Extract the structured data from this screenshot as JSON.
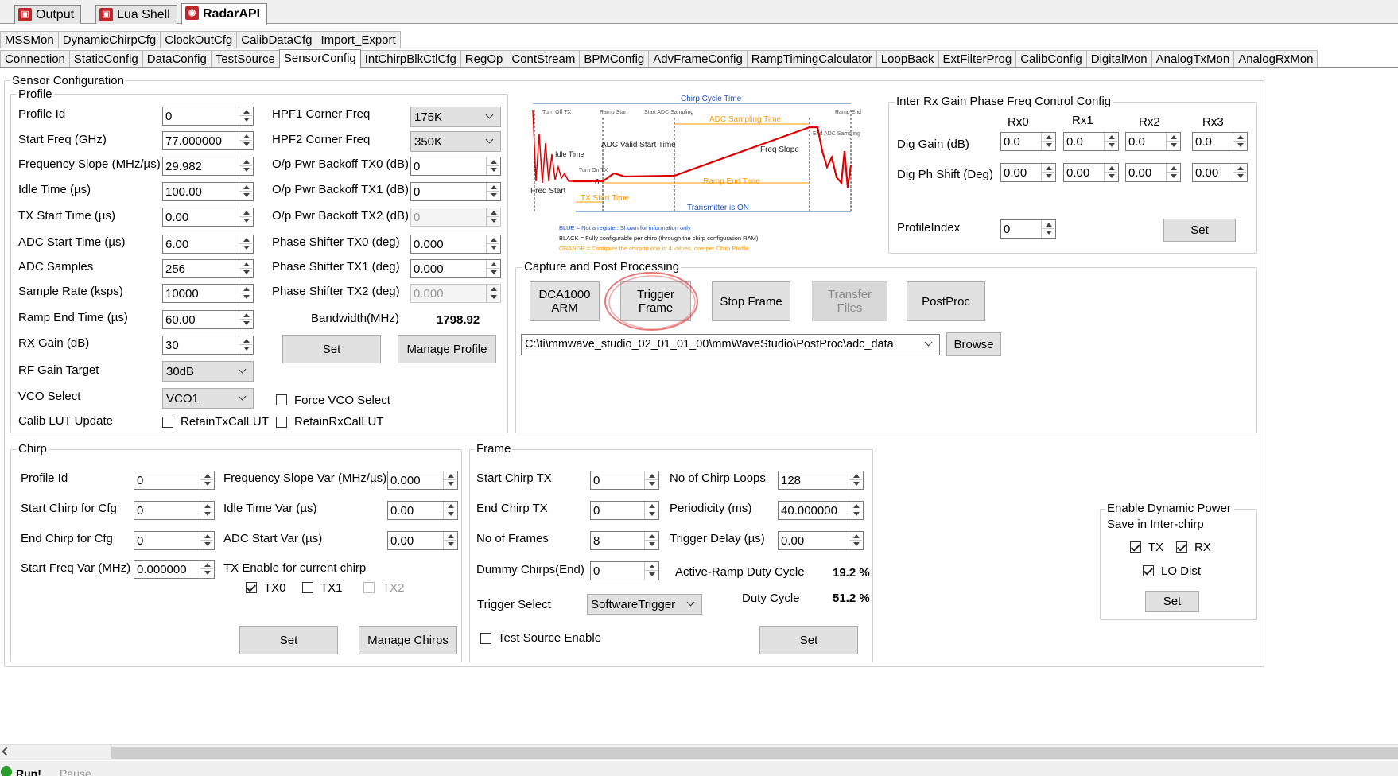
{
  "window_tabs": [
    {
      "label": "Output"
    },
    {
      "label": "Lua Shell"
    },
    {
      "label": "RadarAPI"
    }
  ],
  "tabs_row1": [
    "MSSMon",
    "DynamicChirpCfg",
    "ClockOutCfg",
    "CalibDataCfg",
    "Import_Export"
  ],
  "tabs_row2": [
    "Connection",
    "StaticConfig",
    "DataConfig",
    "TestSource",
    "SensorConfig",
    "IntChirpBlkCtlCfg",
    "RegOp",
    "ContStream",
    "BPMConfig",
    "AdvFrameConfig",
    "RampTimingCalculator",
    "LoopBack",
    "ExtFilterProg",
    "CalibConfig",
    "DigitalMon",
    "AnalogTxMon",
    "AnalogRxMon"
  ],
  "active_tab": "SensorConfig",
  "sensor_config": {
    "title": "Sensor Configuration"
  },
  "profile": {
    "title": "Profile",
    "labels": {
      "profile_id": "Profile Id",
      "start_freq": "Start Freq (GHz)",
      "freq_slope": "Frequency Slope (MHz/µs)",
      "idle_time": "Idle Time (µs)",
      "tx_start": "TX Start Time (µs)",
      "adc_start": "ADC Start Time (µs)",
      "adc_samples": "ADC Samples",
      "sample_rate": "Sample Rate (ksps)",
      "ramp_end": "Ramp End Time (µs)",
      "rx_gain": "RX Gain (dB)",
      "rf_gain": "RF Gain Target",
      "vco": "VCO Select",
      "calib_lut": "Calib LUT Update"
    },
    "values": {
      "profile_id": "0",
      "start_freq": "77.000000",
      "freq_slope": "29.982",
      "idle_time": "100.00",
      "tx_start": "0.00",
      "adc_start": "6.00",
      "adc_samples": "256",
      "sample_rate": "10000",
      "ramp_end": "60.00",
      "rx_gain": "30",
      "rf_gain": "30dB",
      "vco": "VCO1"
    },
    "right_labels": {
      "hpf1": "HPF1 Corner Freq",
      "hpf2": "HPF2 Corner Freq",
      "tx0_backoff": "O/p Pwr Backoff TX0 (dB)",
      "tx1_backoff": "O/p Pwr Backoff TX1 (dB)",
      "tx2_backoff": "O/p Pwr Backoff TX2 (dB)",
      "ps_tx0": "Phase Shifter TX0 (deg)",
      "ps_tx1": "Phase Shifter TX1 (deg)",
      "ps_tx2": "Phase Shifter TX2 (deg)",
      "bandwidth": "Bandwidth(MHz)"
    },
    "right_values": {
      "hpf1": "175K",
      "hpf2": "350K",
      "tx0_backoff": "0",
      "tx1_backoff": "0",
      "tx2_backoff": "0",
      "ps_tx0": "0.000",
      "ps_tx1": "0.000",
      "ps_tx2": "0.000",
      "bandwidth": "1798.92"
    },
    "set": "Set",
    "manage": "Manage Profile",
    "force_vco": "Force VCO Select",
    "retain_tx": "RetainTxCalLUT",
    "retain_rx": "RetainRxCalLUT"
  },
  "diagram": {
    "chirp_cycle": "Chirp Cycle Time",
    "turn_off_tx": "Turn Off TX",
    "ramp_start": "Ramp Start",
    "start_adc": "Start ADC Sampling",
    "adc_sampling_time": "ADC Sampling Time",
    "ramp_end": "Ramp End",
    "end_adc": "End ADC Sampling",
    "adc_valid": "ADC Valid Start Time",
    "idle_time": "Idle Time",
    "turn_on_tx": "Turn On TX",
    "freq_slope": "Freq Slope",
    "freq_start": "Freq Start",
    "ramp_end_time": "Ramp End Time",
    "tx_start_time": "TX Start Time",
    "tx_on": "Transmitter is ON",
    "zero": "0",
    "legend_blue": "BLUE = Not a register. Shown for information only",
    "legend_black": "BLACK = Fully configurable per chirp (through the chirp configuration RAM)",
    "legend_orange": "ORANGE = Configure the chirp to one of 4 values, one per Chirp Profile"
  },
  "gain_phase": {
    "title": "Inter Rx Gain Phase Freq Control Config",
    "cols": [
      "Rx0",
      "Rx1",
      "Rx2",
      "Rx3"
    ],
    "dig_gain": "Dig Gain (dB)",
    "dig_phase": "Dig Ph Shift (Deg)",
    "gain_values": [
      "0.0",
      "0.0",
      "0.0",
      "0.0"
    ],
    "phase_values": [
      "0.00",
      "0.00",
      "0.00",
      "0.00"
    ],
    "profile_index": "ProfileIndex",
    "profile_index_value": "0",
    "set": "Set"
  },
  "capture": {
    "title": "Capture and Post Processing",
    "dca_line1": "DCA1000",
    "dca_line2": "ARM",
    "trig_line1": "Trigger",
    "trig_line2": "Frame",
    "stop": "Stop Frame",
    "transfer_line1": "Transfer",
    "transfer_line2": "Files",
    "postproc": "PostProc",
    "path": "C:\\ti\\mmwave_studio_02_01_01_00\\mmWaveStudio\\PostProc\\adc_data.",
    "browse": "Browse"
  },
  "chirp": {
    "title": "Chirp",
    "profile_id": "Profile Id",
    "start_chirp": "Start Chirp for Cfg",
    "end_chirp": "End Chirp for Cfg",
    "start_freq_var": "Start Freq Var (MHz)",
    "profile_id_v": "0",
    "start_chirp_v": "0",
    "end_chirp_v": "0",
    "start_freq_var_v": "0.000000",
    "slope_var": "Frequency Slope Var (MHz/µs)",
    "idle_var": "Idle Time Var (µs)",
    "adc_var": "ADC Start Var (µs)",
    "slope_var_v": "0.000",
    "idle_var_v": "0.00",
    "adc_var_v": "0.00",
    "tx_enable": "TX Enable for current chirp",
    "tx0": "TX0",
    "tx1": "TX1",
    "tx2": "TX2",
    "set": "Set",
    "manage": "Manage Chirps"
  },
  "frame": {
    "title": "Frame",
    "start_tx": "Start Chirp TX",
    "end_tx": "End Chirp TX",
    "num_frames": "No of Frames",
    "dummy": "Dummy Chirps(End)",
    "start_tx_v": "0",
    "end_tx_v": "0",
    "num_frames_v": "8",
    "dummy_v": "0",
    "loops": "No of Chirp Loops",
    "periodicity": "Periodicity (ms)",
    "trig_delay": "Trigger Delay (µs)",
    "loops_v": "128",
    "periodicity_v": "40.000000",
    "trig_delay_v": "0.00",
    "active_duty": "Active-Ramp Duty Cycle",
    "active_duty_v": "19.2 %",
    "duty": "Duty Cycle",
    "duty_v": "51.2 %",
    "trigger_select": "Trigger Select",
    "trigger_select_v": "SoftwareTrigger",
    "test_source": "Test Source Enable",
    "set": "Set"
  },
  "dyn_power": {
    "title_l1": "Enable Dynamic Power",
    "title_l2": "Save in Inter-chirp",
    "tx": "TX",
    "rx": "RX",
    "lo": "LO Dist",
    "set": "Set"
  },
  "status": {
    "run": "Run!",
    "pause": "Pause"
  }
}
